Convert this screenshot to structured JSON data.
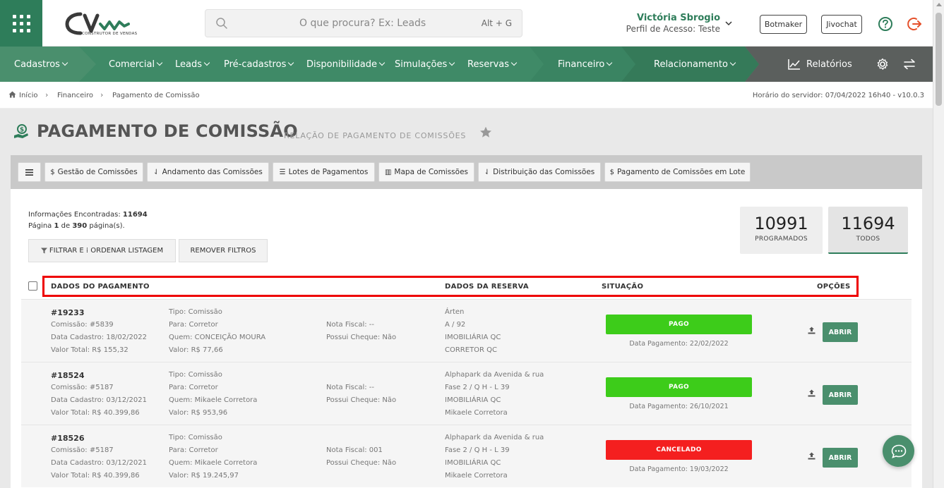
{
  "header": {
    "logo_text": "CONSTRUTOR DE VENDAS",
    "search_placeholder": "O que procura? Ex: Leads",
    "search_shortcut": "Alt + G",
    "user_name": "Victória Sbrogio",
    "user_profile": "Perfil de Acesso: Teste",
    "btn_botmaker": "Botmaker",
    "btn_jivochat": "Jivochat"
  },
  "nav": {
    "cadastros": "Cadastros",
    "comercial": "Comercial",
    "leads": "Leads",
    "pre_cadastros": "Pré-cadastros",
    "disponibilidade": "Disponibilidade",
    "simulacoes": "Simulações",
    "reservas": "Reservas",
    "financeiro": "Financeiro",
    "relacionamento": "Relacionamento",
    "relatorios": "Relatórios"
  },
  "breadcrumb": {
    "home": "Início",
    "financeiro": "Financeiro",
    "current": "Pagamento de Comissão",
    "server_time": "Horário do servidor: 07/04/2022 16h40 - v10.0.3"
  },
  "page": {
    "title": "PAGAMENTO DE COMISSÃO",
    "subtitle": "RELAÇÃO DE PAGAMENTO DE COMISSÕES"
  },
  "toolbar": {
    "gestao": "Gestão de Comissões",
    "andamento": "Andamento das Comissões",
    "lotes": "Lotes de Pagamentos",
    "mapa": "Mapa de Comissões",
    "distribuicao": "Distribuição das Comissões",
    "lote": "Pagamento de Comissões em Lote"
  },
  "info": {
    "found_label": "Informações Encontradas:",
    "found_count": "11694",
    "page_word": "Página",
    "page_num": "1",
    "of_word": "de",
    "page_total": "390",
    "pages_word": "página(s)."
  },
  "filters": {
    "filter_label": "FILTRAR E ⁞ ORDENAR LISTAGEM",
    "remove_label": "REMOVER FILTROS"
  },
  "counters": [
    {
      "num": "10991",
      "label": "PROGRAMADOS"
    },
    {
      "num": "11694",
      "label": "TODOS"
    }
  ],
  "columns": {
    "payment": "DADOS DO PAGAMENTO",
    "reservation": "DADOS DA RESERVA",
    "status": "SITUAÇÃO",
    "options": "OPÇÕES"
  },
  "rows": [
    {
      "id": "#19233",
      "commission": "Comissão: #5839",
      "registered": "Data Cadastro: 18/02/2022",
      "total": "Valor Total: R$ 155,32",
      "type": "Tipo: Comissão",
      "to": "Para: Corretor",
      "who": "Quem: CONCEIÇÃO MOURA",
      "value": "Valor: R$ 77,66",
      "invoice": "Nota Fiscal: --",
      "cheque": "Possui Cheque: Não",
      "res1": "Árten",
      "res2": "A / 92",
      "res3": "IMOBILIÁRIA QC",
      "res4": "CORRETOR QC",
      "status": "PAGO",
      "paydate": "Data Pagamento: 22/02/2022",
      "open": "ABRIR"
    },
    {
      "id": "#18524",
      "commission": "Comissão: #5187",
      "registered": "Data Cadastro: 03/12/2021",
      "total": "Valor Total: R$ 40.399,86",
      "type": "Tipo: Comissão",
      "to": "Para: Corretor",
      "who": "Quem: Mikaele Corretora",
      "value": "Valor: R$ 953,96",
      "invoice": "Nota Fiscal: --",
      "cheque": "Possui Cheque: Não",
      "res1": "Alphapark da Avenida & rua",
      "res2": "Fase 2 / Q H - L 39",
      "res3": "IMOBILIÁRIA QC",
      "res4": "Mikaele Corretora",
      "status": "PAGO",
      "paydate": "Data Pagamento: 26/10/2021",
      "open": "ABRIR"
    },
    {
      "id": "#18526",
      "commission": "Comissão: #5187",
      "registered": "Data Cadastro: 03/12/2021",
      "total": "Valor Total: R$ 40.399,86",
      "type": "Tipo: Comissão",
      "to": "Para: Corretor",
      "who": "Quem: Mikaele Corretora",
      "value": "Valor: R$ 19.245,97",
      "invoice": "Nota Fiscal: 001",
      "cheque": "Possui Cheque: Não",
      "res1": "Alphapark da Avenida & rua",
      "res2": "Fase 2 / Q H - L 39",
      "res3": "IMOBILIÁRIA QC",
      "res4": "Mikaele Corretora",
      "status": "CANCELADO",
      "paydate": "Data Pagamento: 19/03/2022",
      "open": "ABRIR"
    }
  ],
  "colors": {
    "brand_green": "#2e7d5a",
    "nav_green": "#4a8f6d",
    "status_paid": "#3dcc1a",
    "status_cancelled": "#f41f1f",
    "highlight": "#ee0000"
  }
}
